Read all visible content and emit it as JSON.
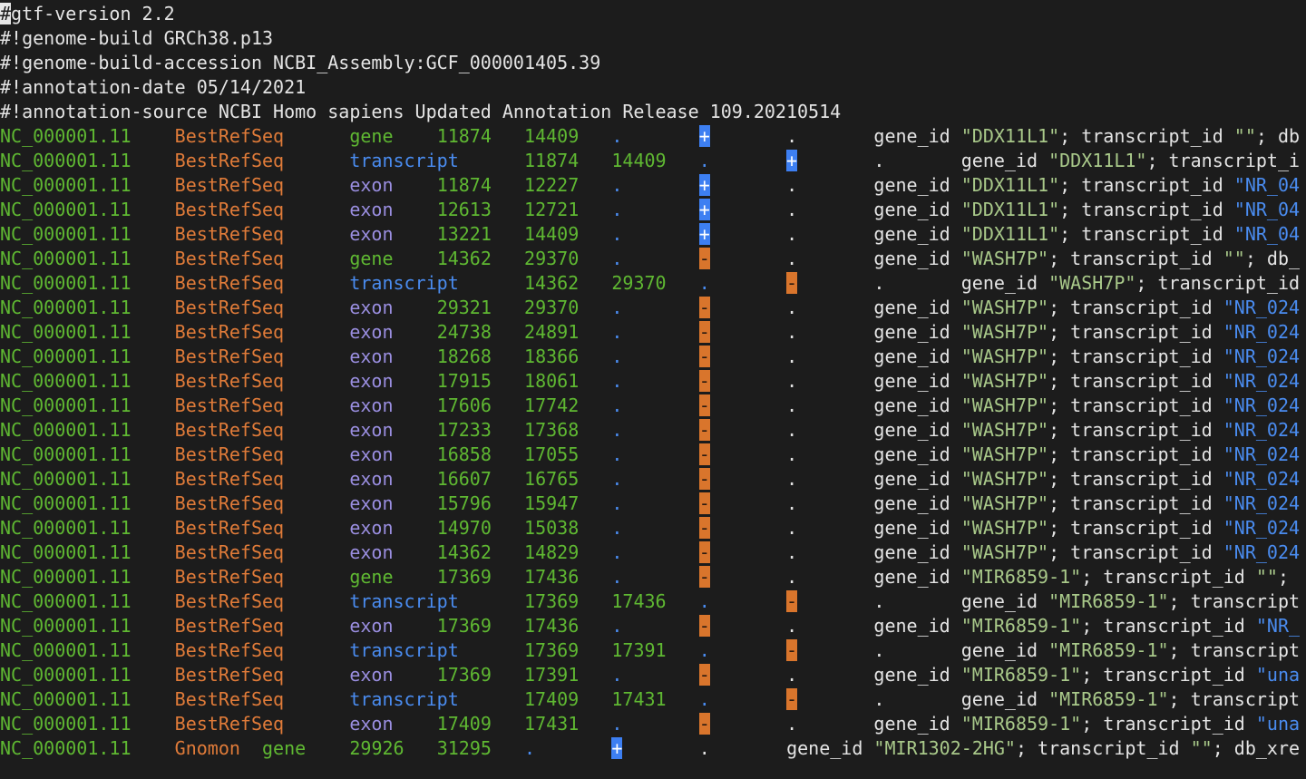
{
  "colors": {
    "background": "#1c1c1c",
    "seqname": "#5fb832",
    "source": "#e07b39",
    "feature_gene": "#5fb832",
    "feature_transcript": "#4a8cf0",
    "feature_exon": "#9a8ee0",
    "strand_plus_bg": "#3d7ff2",
    "strand_minus_bg": "#d9752c"
  },
  "header": {
    "line1_cursor": "#",
    "line1_rest": "gtf-version 2.2",
    "line2": "#!genome-build GRCh38.p13",
    "line3": "#!genome-build-accession NCBI_Assembly:GCF_000001405.39",
    "line4": "#!annotation-date 05/14/2021",
    "line5": "#!annotation-source NCBI Homo sapiens Updated Annotation Release 109.20210514"
  },
  "rows": [
    {
      "seqname": "NC_000001.11",
      "source": "BestRefSeq",
      "feature": "gene",
      "start": "11874",
      "end": "14409",
      "score": ".",
      "strand": "+",
      "frame": ".",
      "attr_key": "gene_id",
      "gene": "\"DDX11L1\"",
      "attr_mid": "; transcript_id ",
      "tid": "\"\"",
      "attr_tail": "; db"
    },
    {
      "seqname": "NC_000001.11",
      "source": "BestRefSeq",
      "feature": "transcript",
      "start": "11874",
      "end": "14409",
      "score": ".",
      "strand": "+",
      "frame": ".",
      "attr_key": "gene_id",
      "gene": "\"DDX11L1\"",
      "attr_mid": "; transcript_i",
      "tid": "",
      "attr_tail": ""
    },
    {
      "seqname": "NC_000001.11",
      "source": "BestRefSeq",
      "feature": "exon",
      "start": "11874",
      "end": "12227",
      "score": ".",
      "strand": "+",
      "frame": ".",
      "attr_key": "gene_id",
      "gene": "\"DDX11L1\"",
      "attr_mid": "; transcript_id ",
      "tid": "\"NR_04",
      "attr_tail": ""
    },
    {
      "seqname": "NC_000001.11",
      "source": "BestRefSeq",
      "feature": "exon",
      "start": "12613",
      "end": "12721",
      "score": ".",
      "strand": "+",
      "frame": ".",
      "attr_key": "gene_id",
      "gene": "\"DDX11L1\"",
      "attr_mid": "; transcript_id ",
      "tid": "\"NR_04",
      "attr_tail": ""
    },
    {
      "seqname": "NC_000001.11",
      "source": "BestRefSeq",
      "feature": "exon",
      "start": "13221",
      "end": "14409",
      "score": ".",
      "strand": "+",
      "frame": ".",
      "attr_key": "gene_id",
      "gene": "\"DDX11L1\"",
      "attr_mid": "; transcript_id ",
      "tid": "\"NR_04",
      "attr_tail": ""
    },
    {
      "seqname": "NC_000001.11",
      "source": "BestRefSeq",
      "feature": "gene",
      "start": "14362",
      "end": "29370",
      "score": ".",
      "strand": "-",
      "frame": ".",
      "attr_key": "gene_id",
      "gene": "\"WASH7P\"",
      "attr_mid": "; transcript_id ",
      "tid": "\"\"",
      "attr_tail": "; db_"
    },
    {
      "seqname": "NC_000001.11",
      "source": "BestRefSeq",
      "feature": "transcript",
      "start": "14362",
      "end": "29370",
      "score": ".",
      "strand": "-",
      "frame": ".",
      "attr_key": "gene_id",
      "gene": "\"WASH7P\"",
      "attr_mid": "; transcript_id",
      "tid": "",
      "attr_tail": ""
    },
    {
      "seqname": "NC_000001.11",
      "source": "BestRefSeq",
      "feature": "exon",
      "start": "29321",
      "end": "29370",
      "score": ".",
      "strand": "-",
      "frame": ".",
      "attr_key": "gene_id",
      "gene": "\"WASH7P\"",
      "attr_mid": "; transcript_id ",
      "tid": "\"NR_024",
      "attr_tail": ""
    },
    {
      "seqname": "NC_000001.11",
      "source": "BestRefSeq",
      "feature": "exon",
      "start": "24738",
      "end": "24891",
      "score": ".",
      "strand": "-",
      "frame": ".",
      "attr_key": "gene_id",
      "gene": "\"WASH7P\"",
      "attr_mid": "; transcript_id ",
      "tid": "\"NR_024",
      "attr_tail": ""
    },
    {
      "seqname": "NC_000001.11",
      "source": "BestRefSeq",
      "feature": "exon",
      "start": "18268",
      "end": "18366",
      "score": ".",
      "strand": "-",
      "frame": ".",
      "attr_key": "gene_id",
      "gene": "\"WASH7P\"",
      "attr_mid": "; transcript_id ",
      "tid": "\"NR_024",
      "attr_tail": ""
    },
    {
      "seqname": "NC_000001.11",
      "source": "BestRefSeq",
      "feature": "exon",
      "start": "17915",
      "end": "18061",
      "score": ".",
      "strand": "-",
      "frame": ".",
      "attr_key": "gene_id",
      "gene": "\"WASH7P\"",
      "attr_mid": "; transcript_id ",
      "tid": "\"NR_024",
      "attr_tail": ""
    },
    {
      "seqname": "NC_000001.11",
      "source": "BestRefSeq",
      "feature": "exon",
      "start": "17606",
      "end": "17742",
      "score": ".",
      "strand": "-",
      "frame": ".",
      "attr_key": "gene_id",
      "gene": "\"WASH7P\"",
      "attr_mid": "; transcript_id ",
      "tid": "\"NR_024",
      "attr_tail": ""
    },
    {
      "seqname": "NC_000001.11",
      "source": "BestRefSeq",
      "feature": "exon",
      "start": "17233",
      "end": "17368",
      "score": ".",
      "strand": "-",
      "frame": ".",
      "attr_key": "gene_id",
      "gene": "\"WASH7P\"",
      "attr_mid": "; transcript_id ",
      "tid": "\"NR_024",
      "attr_tail": ""
    },
    {
      "seqname": "NC_000001.11",
      "source": "BestRefSeq",
      "feature": "exon",
      "start": "16858",
      "end": "17055",
      "score": ".",
      "strand": "-",
      "frame": ".",
      "attr_key": "gene_id",
      "gene": "\"WASH7P\"",
      "attr_mid": "; transcript_id ",
      "tid": "\"NR_024",
      "attr_tail": ""
    },
    {
      "seqname": "NC_000001.11",
      "source": "BestRefSeq",
      "feature": "exon",
      "start": "16607",
      "end": "16765",
      "score": ".",
      "strand": "-",
      "frame": ".",
      "attr_key": "gene_id",
      "gene": "\"WASH7P\"",
      "attr_mid": "; transcript_id ",
      "tid": "\"NR_024",
      "attr_tail": ""
    },
    {
      "seqname": "NC_000001.11",
      "source": "BestRefSeq",
      "feature": "exon",
      "start": "15796",
      "end": "15947",
      "score": ".",
      "strand": "-",
      "frame": ".",
      "attr_key": "gene_id",
      "gene": "\"WASH7P\"",
      "attr_mid": "; transcript_id ",
      "tid": "\"NR_024",
      "attr_tail": ""
    },
    {
      "seqname": "NC_000001.11",
      "source": "BestRefSeq",
      "feature": "exon",
      "start": "14970",
      "end": "15038",
      "score": ".",
      "strand": "-",
      "frame": ".",
      "attr_key": "gene_id",
      "gene": "\"WASH7P\"",
      "attr_mid": "; transcript_id ",
      "tid": "\"NR_024",
      "attr_tail": ""
    },
    {
      "seqname": "NC_000001.11",
      "source": "BestRefSeq",
      "feature": "exon",
      "start": "14362",
      "end": "14829",
      "score": ".",
      "strand": "-",
      "frame": ".",
      "attr_key": "gene_id",
      "gene": "\"WASH7P\"",
      "attr_mid": "; transcript_id ",
      "tid": "\"NR_024",
      "attr_tail": ""
    },
    {
      "seqname": "NC_000001.11",
      "source": "BestRefSeq",
      "feature": "gene",
      "start": "17369",
      "end": "17436",
      "score": ".",
      "strand": "-",
      "frame": ".",
      "attr_key": "gene_id",
      "gene": "\"MIR6859-1\"",
      "attr_mid": "; transcript_id ",
      "tid": "\"\"",
      "attr_tail": ";"
    },
    {
      "seqname": "NC_000001.11",
      "source": "BestRefSeq",
      "feature": "transcript",
      "start": "17369",
      "end": "17436",
      "score": ".",
      "strand": "-",
      "frame": ".",
      "attr_key": "gene_id",
      "gene": "\"MIR6859-1\"",
      "attr_mid": "; transcript",
      "tid": "",
      "attr_tail": ""
    },
    {
      "seqname": "NC_000001.11",
      "source": "BestRefSeq",
      "feature": "exon",
      "start": "17369",
      "end": "17436",
      "score": ".",
      "strand": "-",
      "frame": ".",
      "attr_key": "gene_id",
      "gene": "\"MIR6859-1\"",
      "attr_mid": "; transcript_id ",
      "tid": "\"NR_",
      "attr_tail": ""
    },
    {
      "seqname": "NC_000001.11",
      "source": "BestRefSeq",
      "feature": "transcript",
      "start": "17369",
      "end": "17391",
      "score": ".",
      "strand": "-",
      "frame": ".",
      "attr_key": "gene_id",
      "gene": "\"MIR6859-1\"",
      "attr_mid": "; transcript",
      "tid": "",
      "attr_tail": ""
    },
    {
      "seqname": "NC_000001.11",
      "source": "BestRefSeq",
      "feature": "exon",
      "start": "17369",
      "end": "17391",
      "score": ".",
      "strand": "-",
      "frame": ".",
      "attr_key": "gene_id",
      "gene": "\"MIR6859-1\"",
      "attr_mid": "; transcript_id ",
      "tid": "\"una",
      "attr_tail": ""
    },
    {
      "seqname": "NC_000001.11",
      "source": "BestRefSeq",
      "feature": "transcript",
      "start": "17409",
      "end": "17431",
      "score": ".",
      "strand": "-",
      "frame": ".",
      "attr_key": "gene_id",
      "gene": "\"MIR6859-1\"",
      "attr_mid": "; transcript",
      "tid": "",
      "attr_tail": ""
    },
    {
      "seqname": "NC_000001.11",
      "source": "BestRefSeq",
      "feature": "exon",
      "start": "17409",
      "end": "17431",
      "score": ".",
      "strand": "-",
      "frame": ".",
      "attr_key": "gene_id",
      "gene": "\"MIR6859-1\"",
      "attr_mid": "; transcript_id ",
      "tid": "\"una",
      "attr_tail": ""
    },
    {
      "seqname": "NC_000001.11",
      "source": "Gnomon",
      "feature": "gene",
      "start": "29926",
      "end": "31295",
      "score": ".",
      "strand": "+",
      "frame": ".",
      "attr_key": "gene_id",
      "gene": "\"MIR1302-2HG\"",
      "attr_mid": "; transcript_id ",
      "tid": "\"\"",
      "attr_tail": "; db_xre"
    }
  ]
}
